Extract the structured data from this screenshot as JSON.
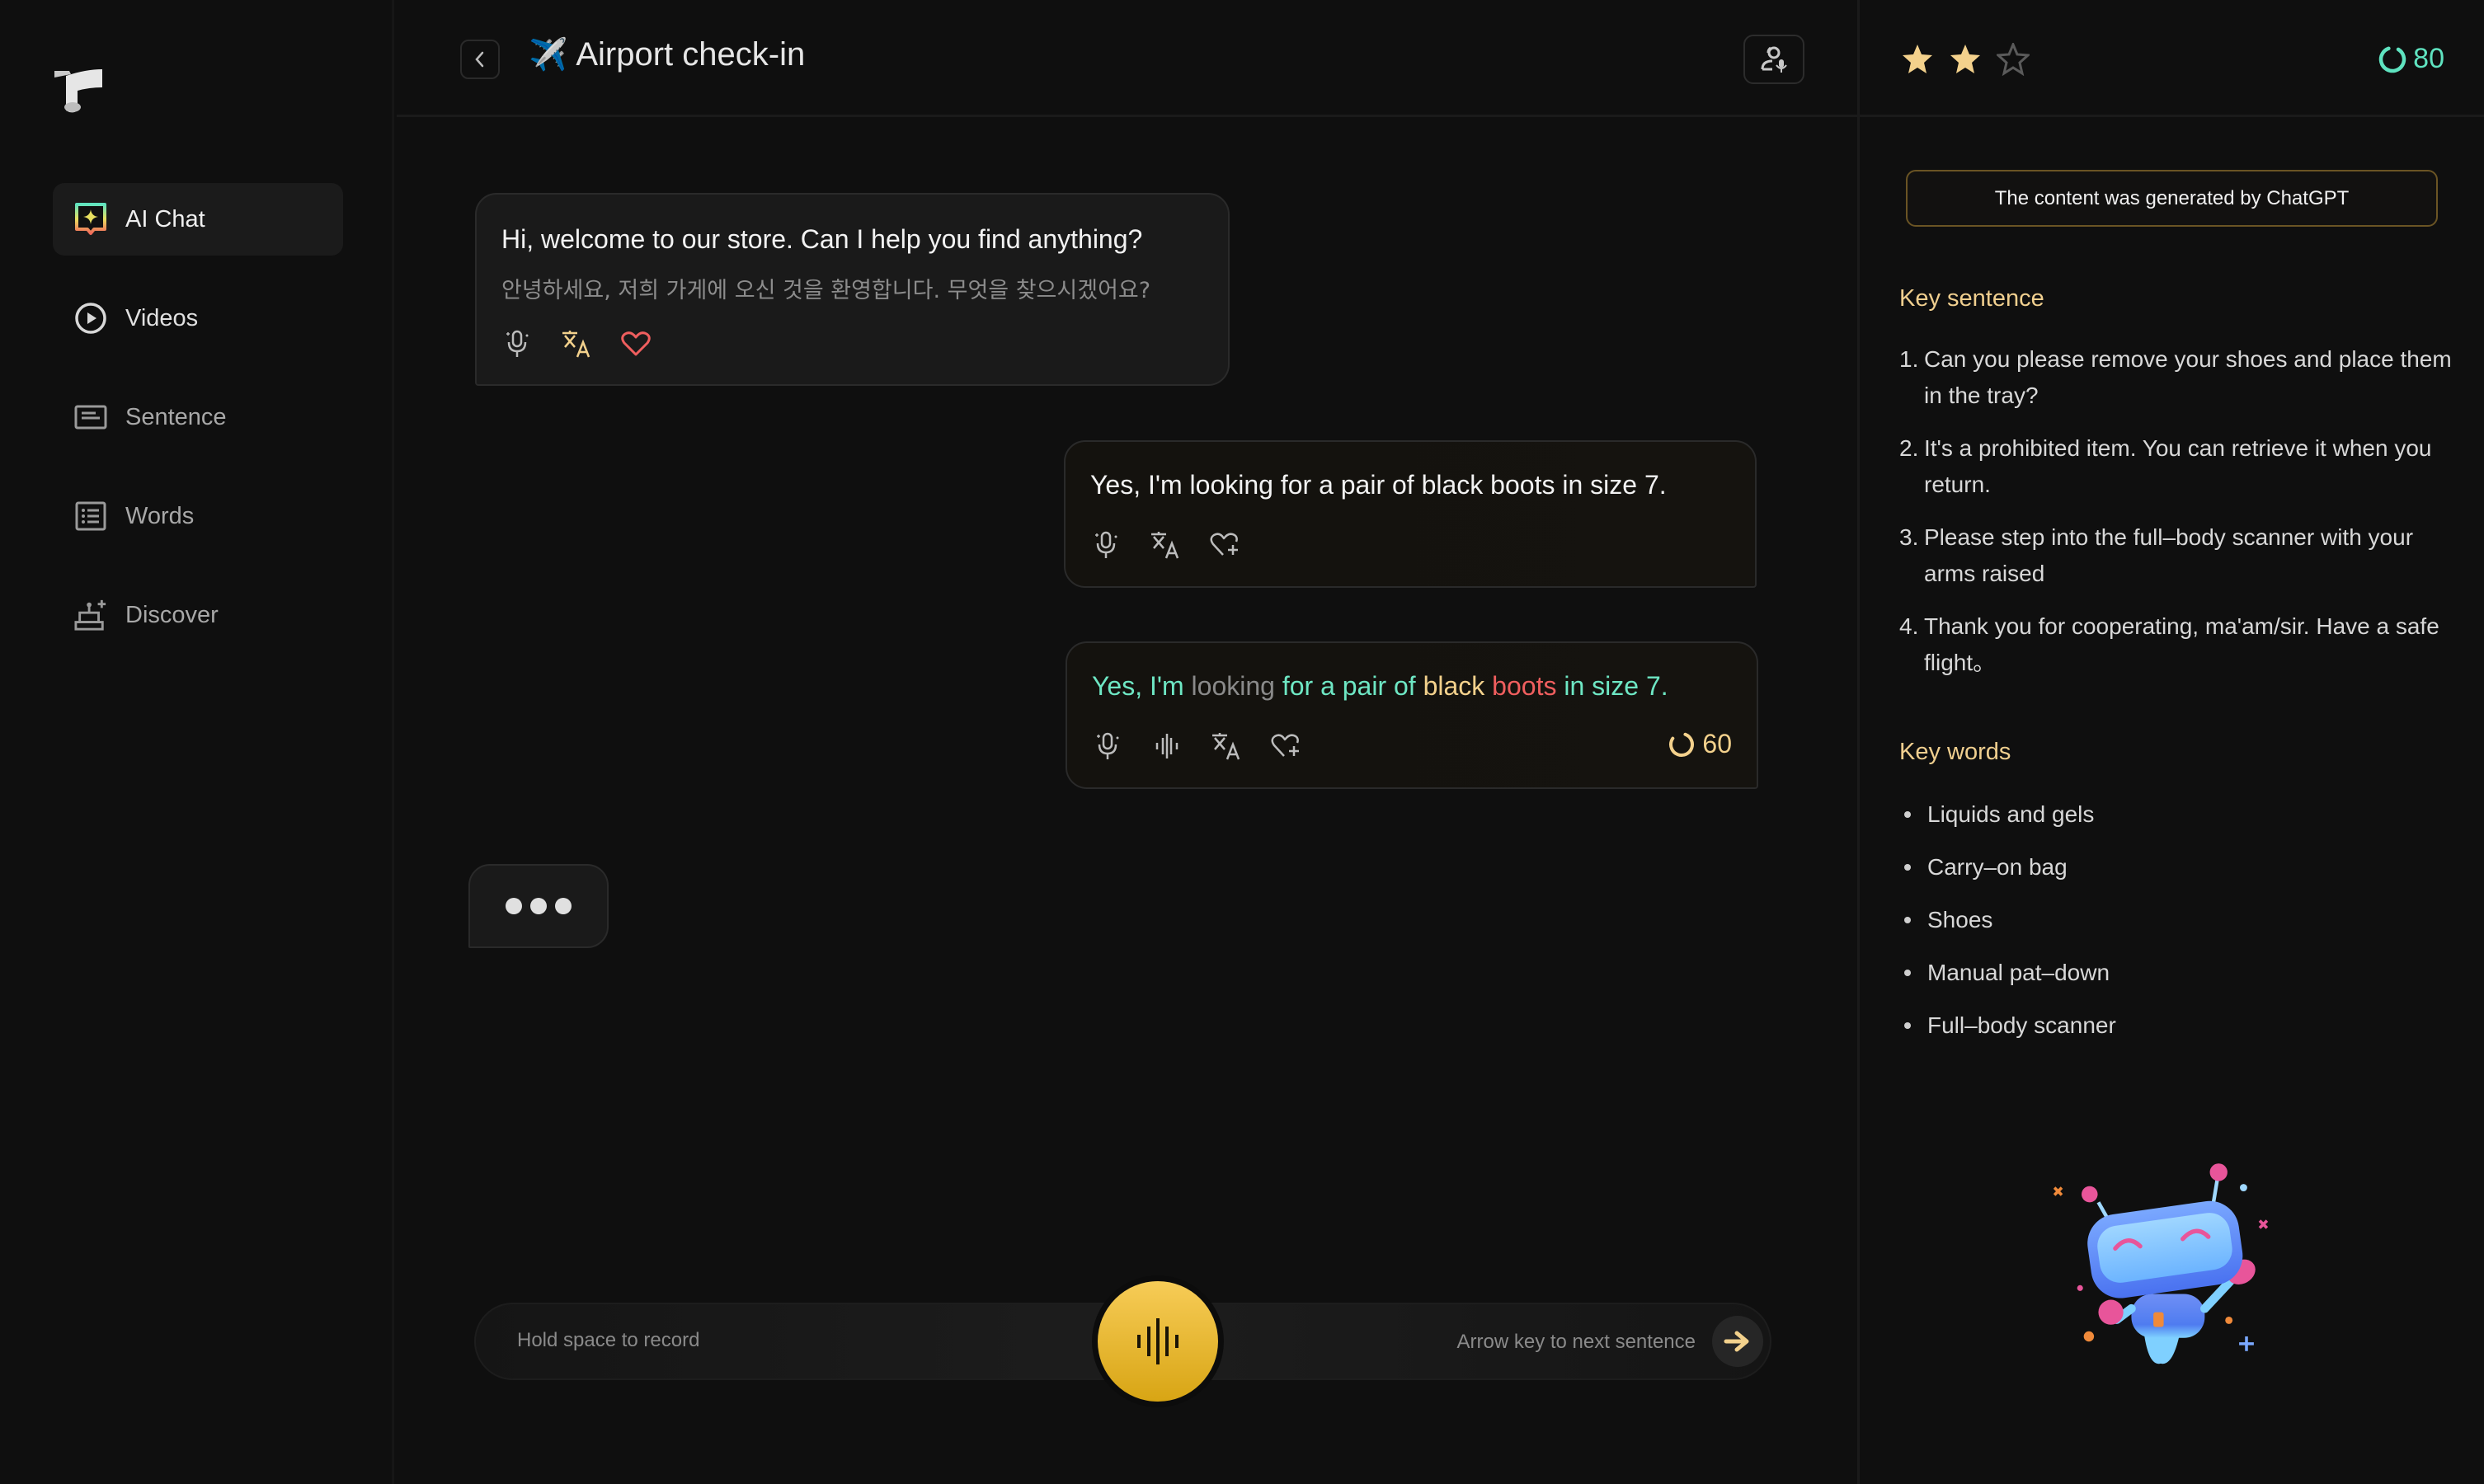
{
  "sidebar": {
    "logo": "app-logo",
    "items": [
      {
        "label": "AI Chat",
        "icon": "ai-chat-icon",
        "active": true
      },
      {
        "label": "Videos",
        "icon": "play-circle-icon",
        "active": false
      },
      {
        "label": "Sentence",
        "icon": "sentence-card-icon",
        "active": false
      },
      {
        "label": "Words",
        "icon": "word-list-icon",
        "active": false
      },
      {
        "label": "Discover",
        "icon": "discover-icon",
        "active": false
      }
    ]
  },
  "header": {
    "back_icon": "chevron-left-icon",
    "title_emoji": "✈️",
    "title": "Airport check-in",
    "role_icon": "role-voice-icon"
  },
  "chat": {
    "messages": [
      {
        "side": "left",
        "text": "Hi, welcome to our store. Can I help you find anything?",
        "translation": "안녕하세요, 저희 가게에 오신 것을 환영합니다. 무엇을 찾으시겠어요?",
        "actions": [
          "voice-mic-icon",
          "translate-icon",
          "heart-icon"
        ],
        "favorited": true
      },
      {
        "side": "right",
        "text": "Yes, I'm looking for a pair of black boots in size 7.",
        "actions": [
          "voice-mic-icon",
          "translate-icon",
          "heart-add-icon"
        ]
      },
      {
        "side": "right",
        "graded": true,
        "words": [
          {
            "w": "Yes, I'm",
            "grade": "good"
          },
          {
            "w": "looking",
            "grade": "miss"
          },
          {
            "w": "for a pair of",
            "grade": "good"
          },
          {
            "w": "black",
            "grade": "mid"
          },
          {
            "w": "boots",
            "grade": "bad"
          },
          {
            "w": "in size 7.",
            "grade": "good"
          }
        ],
        "actions": [
          "voice-mic-icon",
          "waveform-icon",
          "translate-icon",
          "heart-add-icon"
        ],
        "score": "60",
        "score_percent": 60
      }
    ],
    "typing_indicator": true
  },
  "input_bar": {
    "left_hint": "Hold space to record",
    "right_hint": "Arrow key to next sentence",
    "record_icon": "waveform-icon",
    "next_icon": "arrow-right-icon"
  },
  "right_panel": {
    "stars": {
      "filled": 2,
      "total": 3
    },
    "total_score": "80",
    "total_score_percent": 80,
    "notice": "The content was generated by ChatGPT",
    "key_sentence_title": "Key sentence",
    "key_sentences": [
      {
        "num": "1.",
        "text": "Can you please remove your shoes and place them in the tray?"
      },
      {
        "num": "2.",
        "text": "It's a prohibited item. You can retrieve it when you return."
      },
      {
        "num": "3.",
        "text": "Please step into the full–body scanner with your arms raised"
      },
      {
        "num": "4.",
        "text": "Thank you for cooperating, ma'am/sir. Have a safe flight。"
      }
    ],
    "key_words_title": "Key words",
    "key_words": [
      "Liquids and gels",
      "Carry–on bag",
      "Shoes",
      "Manual pat–down",
      "Full–body scanner"
    ],
    "illustration": "robot-mascot"
  },
  "colors": {
    "accent_gold": "#f3d18c",
    "score_green": "#5fe3c0",
    "word_good": "#6ee7c4",
    "word_miss": "#8a8a8a",
    "word_mid": "#f3d18c",
    "word_bad": "#ef5e5e",
    "record_button": "#f2c440"
  }
}
